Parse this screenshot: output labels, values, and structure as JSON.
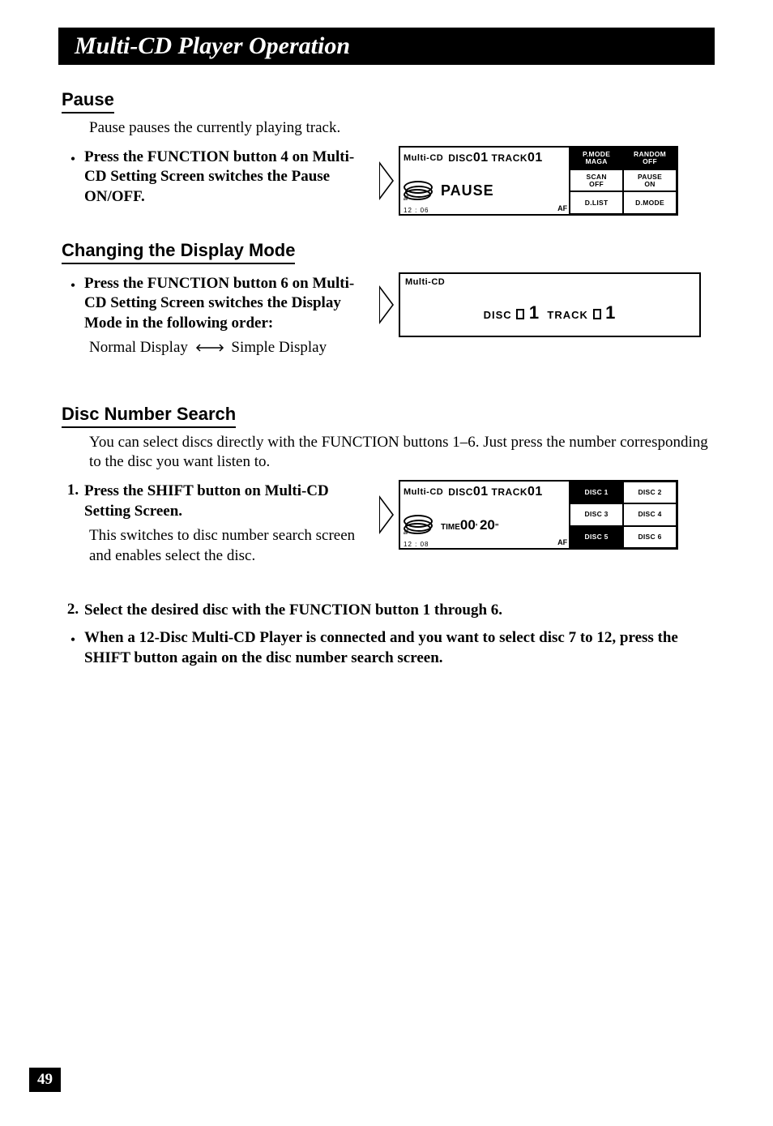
{
  "header": {
    "title": "Multi-CD Player Operation"
  },
  "pause": {
    "heading": "Pause",
    "desc": "Pause pauses the currently playing track.",
    "bullet": "Press the FUNCTION button 4 on Multi-CD Setting Screen switches the Pause ON/OFF."
  },
  "display_mode": {
    "heading": "Changing the Display Mode",
    "bullet": "Press the FUNCTION button 6 on Multi-CD Setting Screen switches the Display Mode in the following order:",
    "order_left": "Normal Display",
    "order_right": "Simple Display"
  },
  "disc_search": {
    "heading": "Disc Number Search",
    "desc": "You can select discs directly with the FUNCTION buttons 1–6. Just press the number corresponding to the disc you want listen to.",
    "step1_title": "Press the SHIFT button on Multi-CD Setting Screen.",
    "step1_desc": "This switches to disc number search screen and enables select the disc.",
    "step2": "Select the desired disc with the FUNCTION button 1 through 6.",
    "note": "When a 12-Disc Multi-CD Player is connected and you want to select disc 7 to 12, press the SHIFT button again on the disc number search screen."
  },
  "screen_pause": {
    "source": "Multi-CD",
    "disc_label": "DISC",
    "disc_num": "01",
    "track_label": "TRACK",
    "track_num": "01",
    "center": "PAUSE",
    "clock": "12 : 06",
    "af": "AF",
    "softkeys": [
      {
        "l1": "P.MODE",
        "l2": "MAGA",
        "inv": true
      },
      {
        "l1": "RANDOM",
        "l2": "OFF",
        "inv": true
      },
      {
        "l1": "SCAN",
        "l2": "OFF",
        "inv": false
      },
      {
        "l1": "PAUSE",
        "l2": "ON",
        "inv": false
      },
      {
        "l1": "D.LIST",
        "l2": "",
        "inv": false
      },
      {
        "l1": "D.MODE",
        "l2": "",
        "inv": false
      }
    ]
  },
  "screen_simple": {
    "source": "Multi-CD",
    "line_disc": "DISC",
    "line_disc_num": "1",
    "line_track": "TRACK",
    "line_track_num": "1"
  },
  "screen_discsel": {
    "source": "Multi-CD",
    "disc_label": "DISC",
    "disc_num": "01",
    "track_label": "TRACK",
    "track_num": "01",
    "time_label": "TIME",
    "time_min": "00",
    "time_sec": "20",
    "clock": "12 : 08",
    "af": "AF",
    "softkeys": [
      {
        "l1": "DISC 1",
        "inv": true
      },
      {
        "l1": "DISC 2",
        "inv": false
      },
      {
        "l1": "DISC 3",
        "inv": false
      },
      {
        "l1": "DISC 4",
        "inv": false
      },
      {
        "l1": "DISC 5",
        "inv": true
      },
      {
        "l1": "DISC 6",
        "inv": false
      }
    ]
  },
  "page_number": "49"
}
